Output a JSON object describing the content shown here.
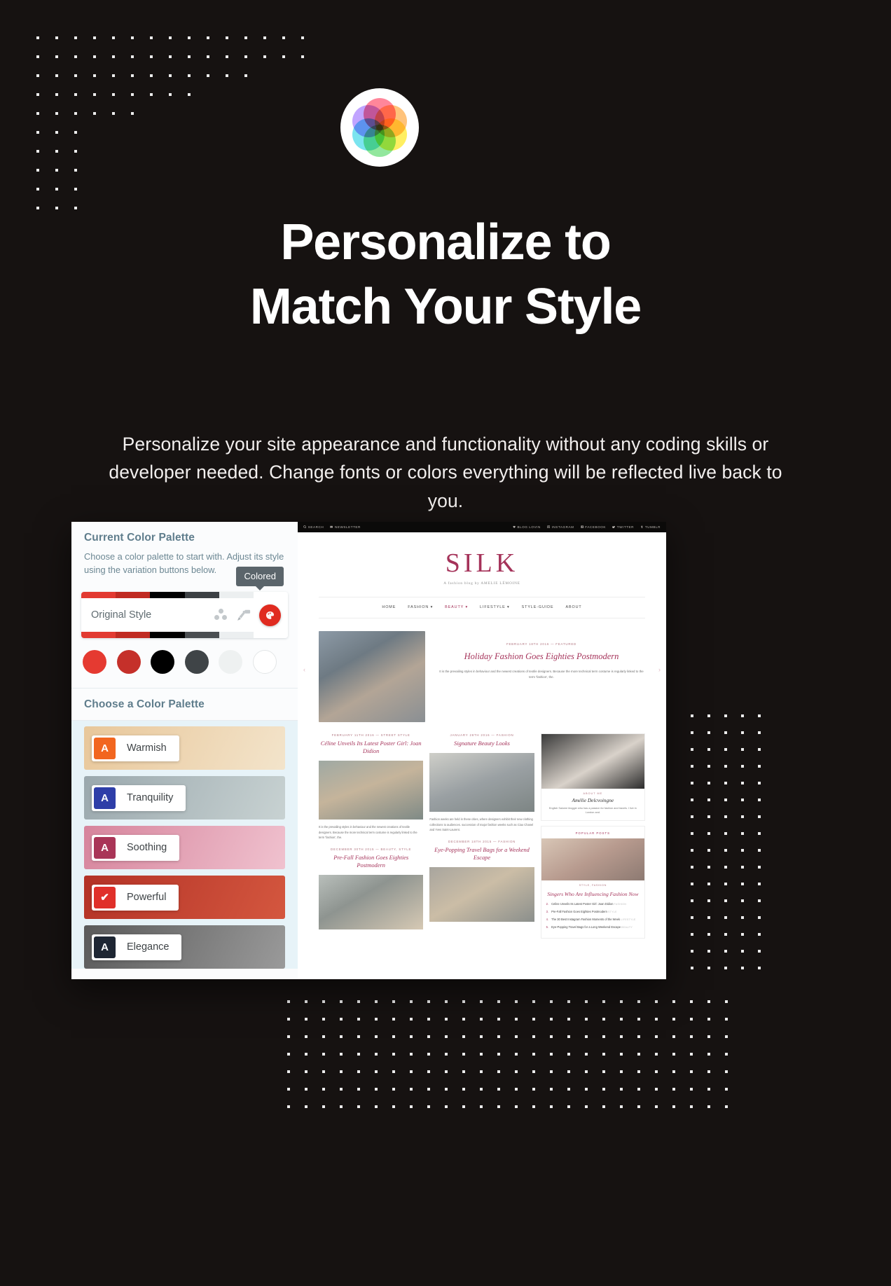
{
  "hero": {
    "title_line1": "Personalize to",
    "title_line2": "Match Your Style",
    "subtitle": "Personalize your site appearance and functionality without any coding skills or developer needed. Change fonts or colors everything will be reflected live back to you.",
    "logo_icon": "color-wheel-icon",
    "background_color": "#161211",
    "text_color": "#ffffff"
  },
  "customizer": {
    "current_section": {
      "heading": "Current Color Palette",
      "description": "Choose a color palette to start with. Adjust its style using the variation buttons below.",
      "style_row": {
        "label": "Original Style",
        "dots_icon": "color-variation-dots-icon",
        "roller_icon": "paint-roller-icon",
        "active_icon": "colored-circle-icon",
        "tooltip": "Colored",
        "strip_top_colors": [
          "#e23a31",
          "#c02b22",
          "#000000",
          "#3d4144",
          "#eceff0",
          "#ffffff"
        ],
        "strip_bottom_colors": [
          "#e23a31",
          "#c02b22",
          "#000000",
          "#4a4e51",
          "#eceff0",
          "#ffffff"
        ]
      },
      "swatches": [
        "#e53a31",
        "#c5302a",
        "#000000",
        "#3f4447",
        "#eef1f1",
        "#ffffff"
      ]
    },
    "choose_section": {
      "heading": "Choose a Color Palette",
      "palettes": [
        {
          "name": "Warmish",
          "badge": "A",
          "badge_color": "#f2661f",
          "selected": false,
          "bg_from": "#e8c79a",
          "bg_to": "#f3e4cb"
        },
        {
          "name": "Tranquility",
          "badge": "A",
          "badge_color": "#2e3ea8",
          "selected": false,
          "bg_from": "#9aa8ad",
          "bg_to": "#c8d2d2"
        },
        {
          "name": "Soothing",
          "badge": "A",
          "badge_color": "#a93557",
          "selected": false,
          "bg_from": "#d6849c",
          "bg_to": "#f0c2cf"
        },
        {
          "name": "Powerful",
          "badge": "✔",
          "badge_color": "#e0302a",
          "selected": true,
          "bg_from": "#b33226",
          "bg_to": "#d4573f"
        },
        {
          "name": "Elegance",
          "badge": "A",
          "badge_color": "#1e2633",
          "selected": false,
          "bg_from": "#5a5a5a",
          "bg_to": "#9a9a9a"
        }
      ]
    }
  },
  "preview": {
    "topbar": {
      "left": [
        {
          "icon": "search-icon",
          "label": "SEARCH"
        },
        {
          "icon": "mail-icon",
          "label": "NEWSLETTER"
        }
      ],
      "right": [
        {
          "icon": "heart-icon",
          "label": "BLOG LOVIN"
        },
        {
          "icon": "instagram-icon",
          "label": "INSTAGRAM"
        },
        {
          "icon": "facebook-icon",
          "label": "FACEBOOK"
        },
        {
          "icon": "twitter-icon",
          "label": "TWITTER"
        },
        {
          "icon": "tumblr-icon",
          "label": "TUMBLR"
        }
      ]
    },
    "site_title": "SILK",
    "site_tagline": "A fashion blog by AMELIE LÉMOINE",
    "nav": [
      {
        "label": "HOME",
        "active": false
      },
      {
        "label": "FASHION ▾",
        "active": false
      },
      {
        "label": "BEAUTY ▾",
        "active": true
      },
      {
        "label": "LIFESTYLE ▾",
        "active": false
      },
      {
        "label": "STYLE-GUIDE",
        "active": false
      },
      {
        "label": "ABOUT",
        "active": false
      }
    ],
    "featured": {
      "meta": "FEBRUARY 18TH 2016 — FEATURED",
      "title": "Holiday Fashion Goes Eighties Postmodern",
      "excerpt": "It is the prevailing styles in behaviour and the newest creations of textile designers. Because the more technical term costume is regularly linked to the term 'fashion', the."
    },
    "cards": [
      {
        "meta": "FEBRUARY 11TH 2016 — STREET STYLE",
        "title": "Céline Unveils Its Latest Poster Girl: Joan Didion",
        "excerpt": "It is the prevailing styles in behaviour and the newest creations of textile designers. Because the more technical term costume is regularly linked to the term 'fashion', the."
      },
      {
        "meta": "JANUARY 28TH 2016 — FASHION",
        "title": "Signature Beauty Looks",
        "excerpt": "Fashion weeks are held in these cities, where designers exhibit their new clothing collections to audiences. succession of major fashion weeks such as Ciao Chanel and Yves Saint-Laurent."
      },
      {
        "meta": "DECEMBER 30TH 2015 — BEAUTY, STYLE",
        "title": "Pre-Fall Fashion Goes Eighties Postmodern",
        "excerpt": ""
      },
      {
        "meta": "DECEMBER 18TH 2015 — FASHION",
        "title": "Eye-Popping Travel Bags for a Weekend Escape",
        "excerpt": ""
      }
    ],
    "sidebar": {
      "about_label": "ABOUT ME",
      "about_name": "Amélie Delcvoingne",
      "about_text": "English Salome blogger who has a passion for fashion and travels. I live in London and.",
      "popular_label": "POPULAR POSTS",
      "popular_feature": {
        "category": "STYLE, FASHION",
        "title": "Singers Who Are Influencing Fashion Now"
      },
      "popular_items": [
        {
          "num": "2.",
          "title": "Celine Unveils Its Latest Poster Girl: Joan Didion",
          "cat": "FASHION"
        },
        {
          "num": "3.",
          "title": "Pre-Fall Fashion Goes Eighties Postmodern",
          "cat": "STYLE"
        },
        {
          "num": "4.",
          "title": "The 30 Best Instagram Fashion Moments of the Week",
          "cat": "LIFESTYLE"
        },
        {
          "num": "5.",
          "title": "Eye-Popping Travel Bags for a Long Weekend Escape",
          "cat": "BEAUTY"
        }
      ]
    },
    "nav_arrows": {
      "left": "‹",
      "right": "›"
    }
  }
}
